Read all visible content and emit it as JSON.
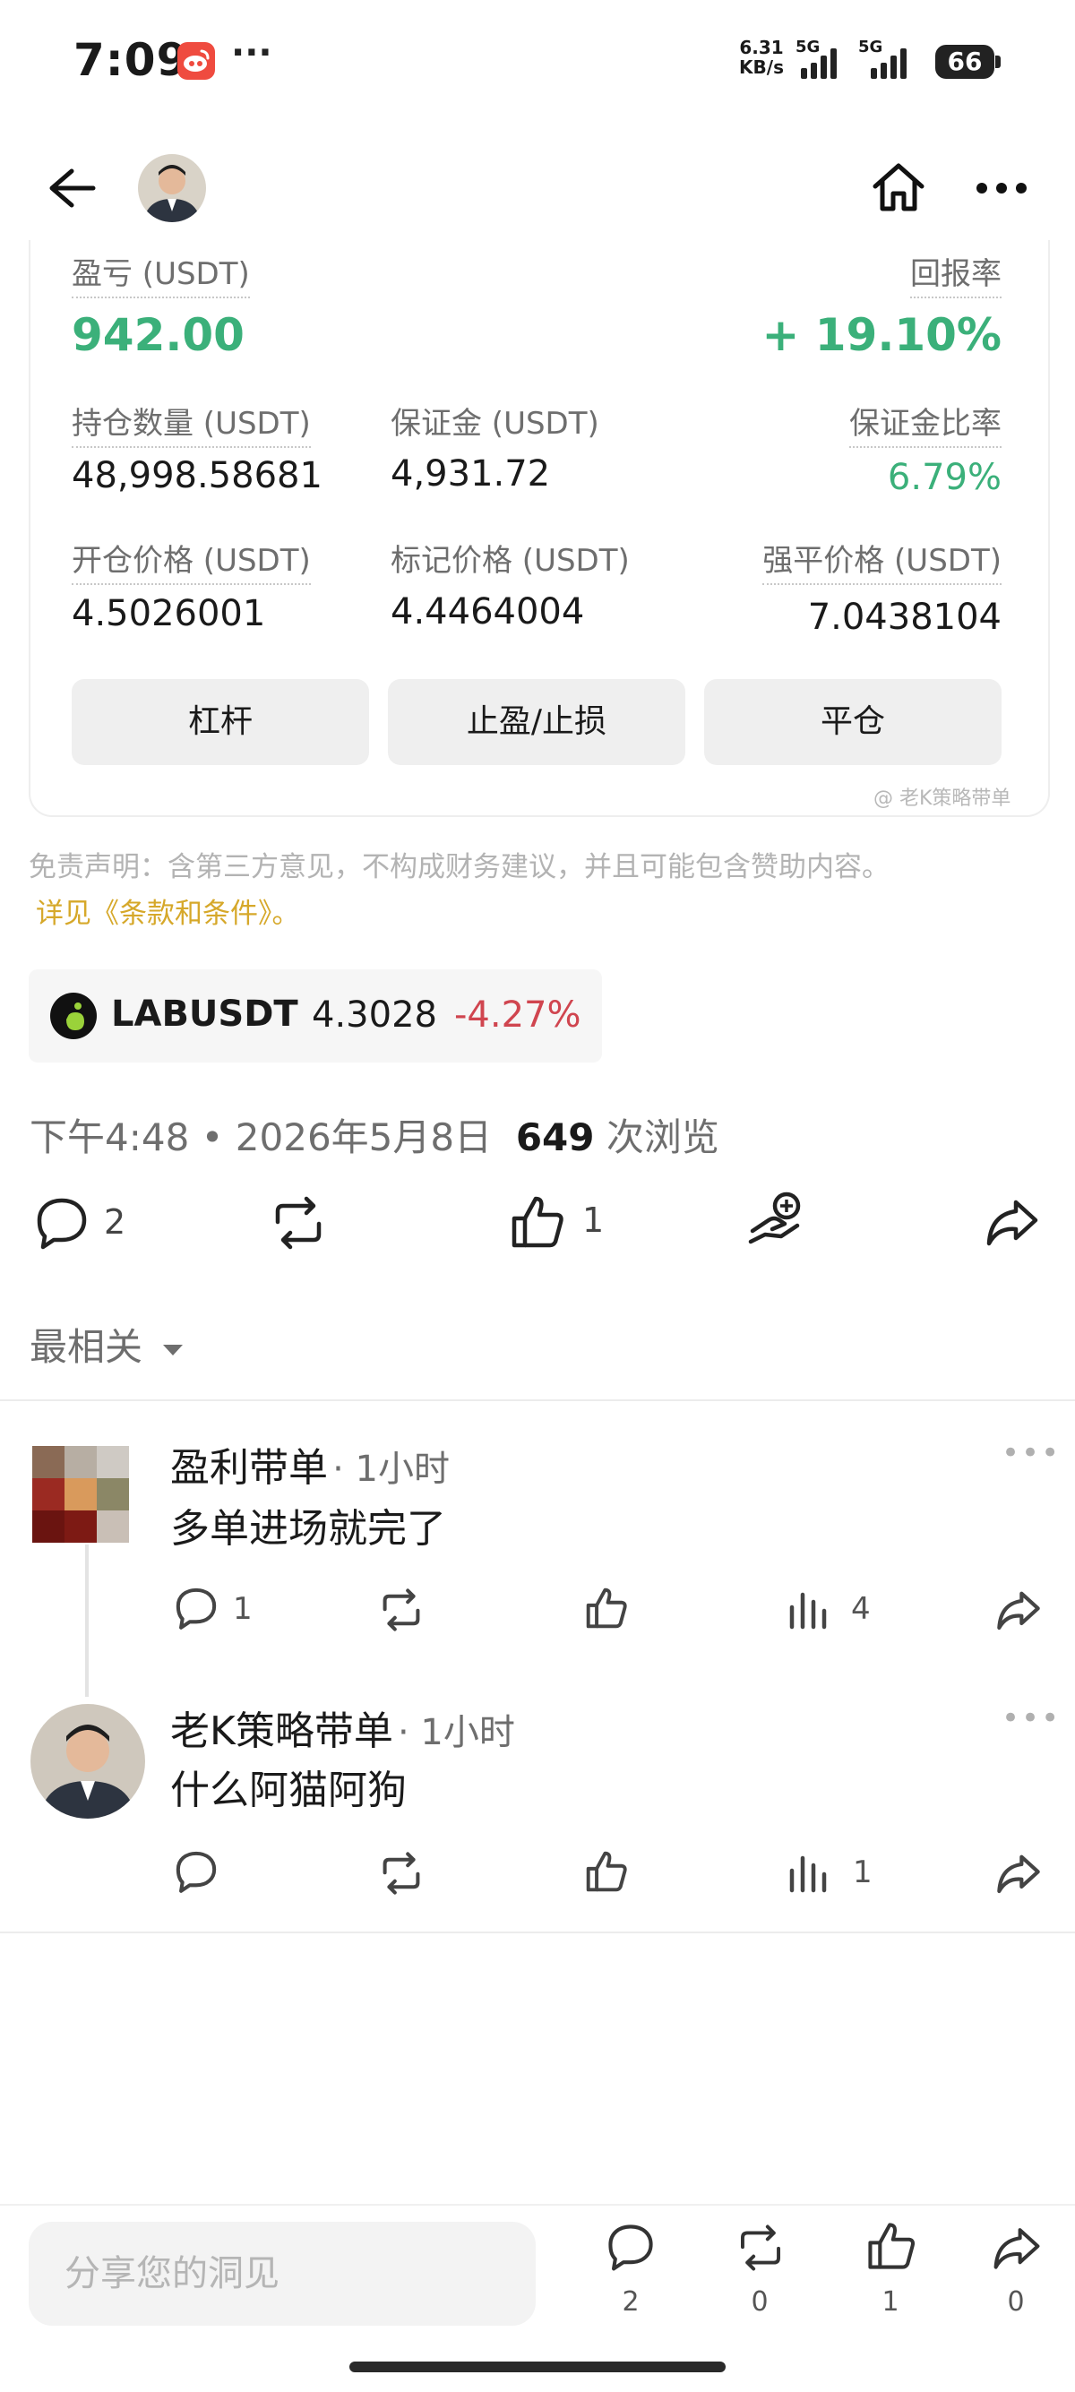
{
  "status_bar": {
    "time": "7:09",
    "more": "···",
    "net_speed_value": "6.31",
    "net_speed_unit": "KB/s",
    "sim1": "5G",
    "sim2": "5G",
    "battery": "66"
  },
  "position": {
    "pnl_label": "盈亏 (USDT)",
    "pnl_value": "942.00",
    "roi_label": "回报率",
    "roi_value": "+ 19.10%",
    "size_label": "持仓数量 (USDT)",
    "size_value": "48,998.58681",
    "margin_label": "保证金 (USDT)",
    "margin_value": "4,931.72",
    "margin_ratio_label": "保证金比率",
    "margin_ratio_value": "6.79%",
    "entry_label": "开仓价格 (USDT)",
    "entry_value": "4.5026001",
    "mark_label": "标记价格 (USDT)",
    "mark_value": "4.4464004",
    "liq_label": "强平价格 (USDT)",
    "liq_value": "7.0438104",
    "btn_leverage": "杠杆",
    "btn_tpsl": "止盈/止损",
    "btn_close": "平仓",
    "watermark": "@ 老K策略带单"
  },
  "disclaimer": "免责声明：含第三方意见，不构成财务建议，并且可能包含赞助内容。",
  "terms_link": "详见《条款和条件》。",
  "ticker": {
    "symbol": "LABUSDT",
    "price": "4.3028",
    "change": "-4.27%"
  },
  "post_meta": {
    "time": "下午4:48 • 2026年5月8日",
    "views": "649",
    "views_label": "次浏览"
  },
  "post_actions": {
    "comments": "2",
    "likes": "1"
  },
  "sort": {
    "label": "最相关"
  },
  "comments": [
    {
      "name": "盈利带单",
      "time": "· 1小时",
      "text": "多单进场就完了",
      "replies": "1",
      "views": "4"
    },
    {
      "name": "老K策略带单",
      "time": "· 1小时",
      "text": "什么阿猫阿狗",
      "replies": "",
      "views": "1"
    }
  ],
  "bottom_bar": {
    "placeholder": "分享您的洞见",
    "comments": "2",
    "reposts": "0",
    "likes": "1",
    "shares": "0"
  }
}
